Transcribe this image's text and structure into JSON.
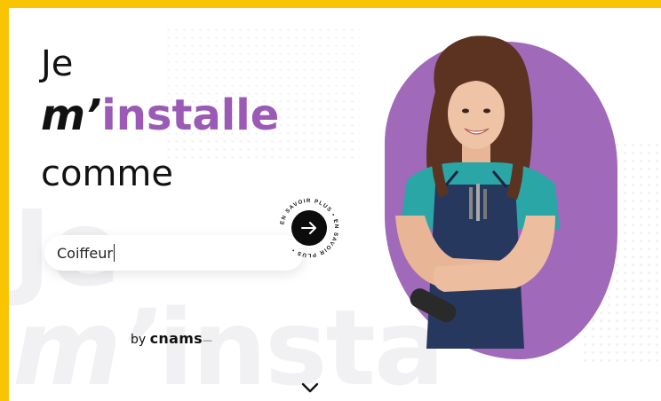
{
  "hero": {
    "line1": "Je",
    "line2_em": "m’",
    "line2_rest": "installe",
    "line3": "comme"
  },
  "search": {
    "value": "Coiffeur"
  },
  "cta": {
    "ring_text": "EN SAVOIR PLUS • EN SAVOIR PLUS •"
  },
  "byline": {
    "prefix": "by",
    "brand": "cnams",
    "suffix": "—"
  },
  "watermark": {
    "line1": "Je",
    "line2_em": "m’",
    "line2_rest": "insta"
  },
  "colors": {
    "frame": "#f9c400",
    "accent": "#9a5ab5",
    "dark": "#0c0c0c"
  },
  "icons": {
    "cta": "arrow-right-icon",
    "scroll": "chevron-down-icon"
  }
}
